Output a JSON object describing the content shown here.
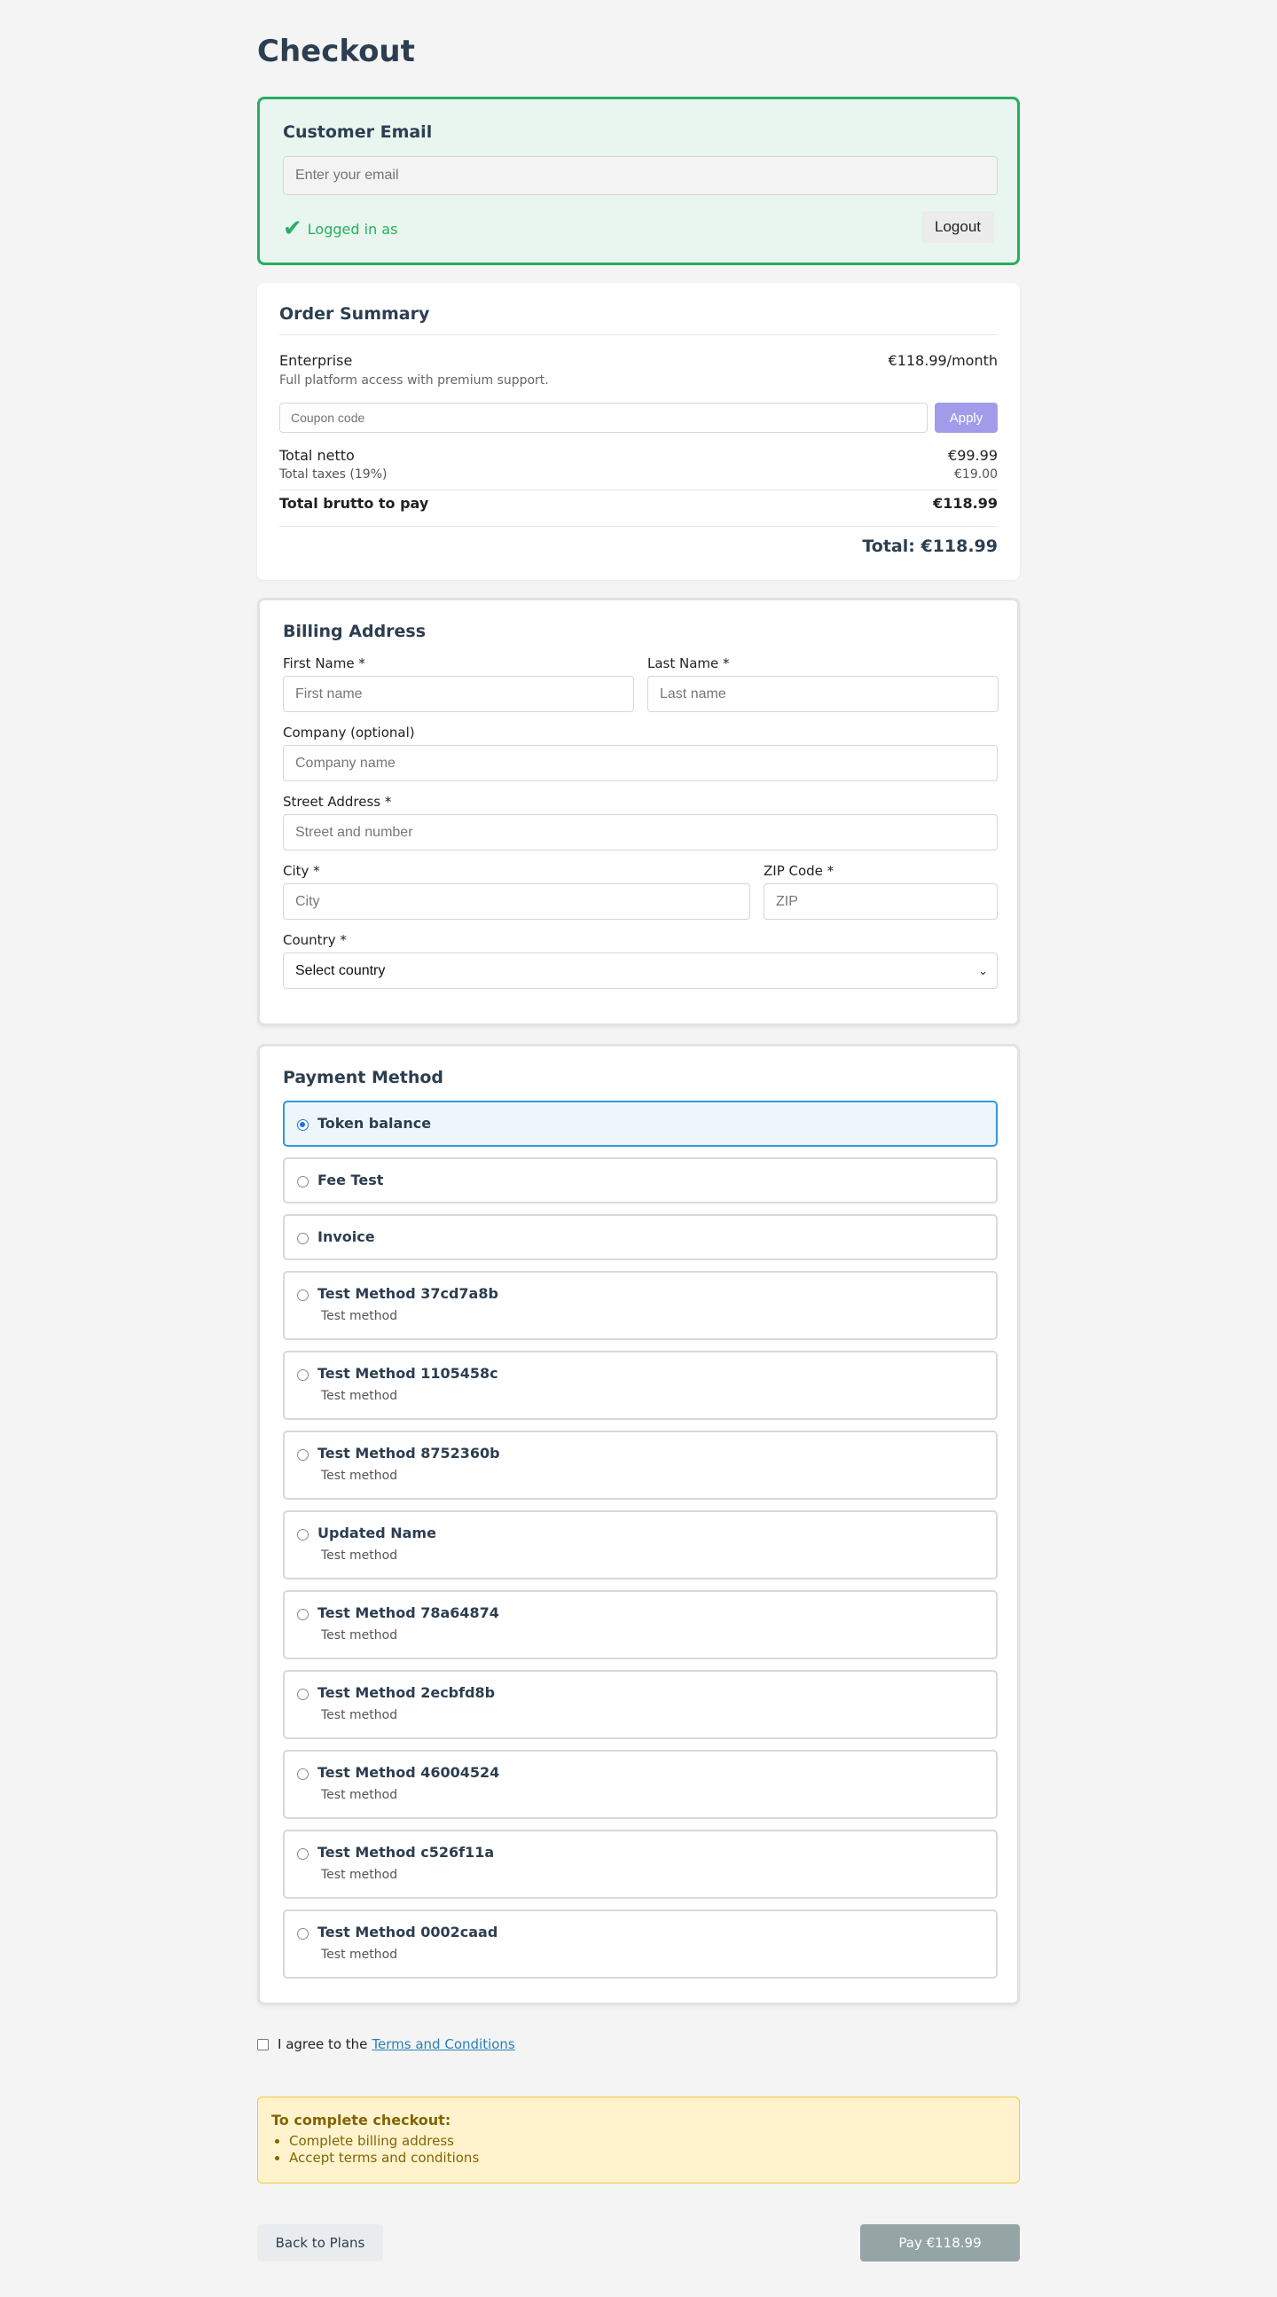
{
  "page": {
    "title": "Checkout"
  },
  "email": {
    "heading": "Customer Email",
    "placeholder": "Enter your email",
    "logged_in_text": "Logged in as",
    "logout_label": "Logout"
  },
  "order": {
    "heading": "Order Summary",
    "plan_name": "Enterprise",
    "plan_price": "€118.99/month",
    "plan_desc": "Full platform access with premium support.",
    "coupon_placeholder": "Coupon code",
    "apply_label": "Apply",
    "netto_label": "Total netto",
    "netto_value": "€99.99",
    "taxes_label": "Total taxes (19%)",
    "taxes_value": "€19.00",
    "brutto_label": "Total brutto to pay",
    "brutto_value": "€118.99",
    "total_text": "Total: €118.99"
  },
  "billing": {
    "heading": "Billing Address",
    "first_name_label": "First Name *",
    "first_name_placeholder": "First name",
    "last_name_label": "Last Name *",
    "last_name_placeholder": "Last name",
    "company_label": "Company (optional)",
    "company_placeholder": "Company name",
    "street_label": "Street Address *",
    "street_placeholder": "Street and number",
    "city_label": "City *",
    "city_placeholder": "City",
    "zip_label": "ZIP Code *",
    "zip_placeholder": "ZIP",
    "country_label": "Country *",
    "country_value": "Select country"
  },
  "payment": {
    "heading": "Payment Method",
    "methods": [
      {
        "name": "Token balance",
        "desc": "",
        "selected": true
      },
      {
        "name": "Fee Test",
        "desc": "",
        "selected": false
      },
      {
        "name": "Invoice",
        "desc": "",
        "selected": false
      },
      {
        "name": "Test Method 37cd7a8b",
        "desc": "Test method",
        "selected": false
      },
      {
        "name": "Test Method 1105458c",
        "desc": "Test method",
        "selected": false
      },
      {
        "name": "Test Method 8752360b",
        "desc": "Test method",
        "selected": false
      },
      {
        "name": "Updated Name",
        "desc": "Test method",
        "selected": false
      },
      {
        "name": "Test Method 78a64874",
        "desc": "Test method",
        "selected": false
      },
      {
        "name": "Test Method 2ecbfd8b",
        "desc": "Test method",
        "selected": false
      },
      {
        "name": "Test Method 46004524",
        "desc": "Test method",
        "selected": false
      },
      {
        "name": "Test Method c526f11a",
        "desc": "Test method",
        "selected": false
      },
      {
        "name": "Test Method 0002caad",
        "desc": "Test method",
        "selected": false
      }
    ]
  },
  "terms": {
    "prefix": "I agree to the",
    "link": "Terms and Conditions"
  },
  "warning": {
    "title": "To complete checkout:",
    "items": [
      "Complete billing address",
      "Accept terms and conditions"
    ]
  },
  "actions": {
    "back_label": "Back to Plans",
    "pay_label": "Pay €118.99"
  },
  "colors": {
    "accent_green": "#27ae60",
    "accent_blue": "#3498db",
    "apply_purple": "#a29bea",
    "pay_disabled": "#95a5a6",
    "warning_bg": "#fff3cd"
  }
}
